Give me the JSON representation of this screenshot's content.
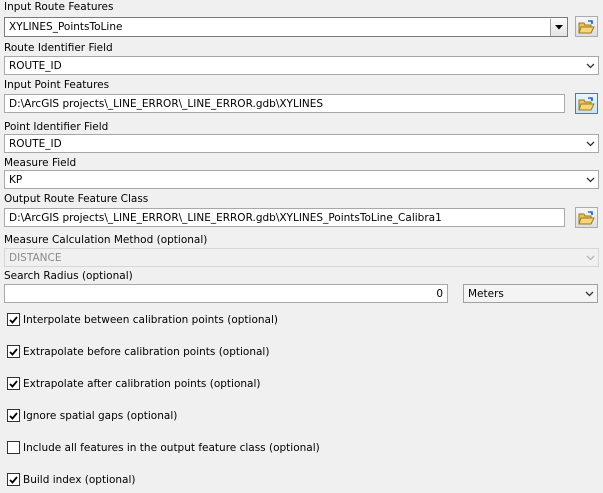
{
  "input_route_features": {
    "label": "Input Route Features",
    "value": "XYLINES_PointsToLine"
  },
  "route_identifier_field": {
    "label": "Route Identifier Field",
    "value": "ROUTE_ID"
  },
  "input_point_features": {
    "label": "Input Point Features",
    "value": "D:\\ArcGIS projects\\_LINE_ERROR\\_LINE_ERROR.gdb\\XYLINES"
  },
  "point_identifier_field": {
    "label": "Point Identifier Field",
    "value": "ROUTE_ID"
  },
  "measure_field": {
    "label": "Measure Field",
    "value": "KP"
  },
  "output_route_feature_class": {
    "label": "Output Route Feature Class",
    "value": "D:\\ArcGIS projects\\_LINE_ERROR\\_LINE_ERROR.gdb\\XYLINES_PointsToLine_Calibra1"
  },
  "measure_calculation_method": {
    "label": "Measure Calculation Method (optional)",
    "value": "DISTANCE"
  },
  "search_radius": {
    "label": "Search Radius (optional)",
    "value": "0",
    "units": "Meters"
  },
  "options": [
    {
      "label": "Interpolate between calibration points (optional)",
      "checked": true
    },
    {
      "label": "Extrapolate before calibration points (optional)",
      "checked": true
    },
    {
      "label": "Extrapolate after calibration points (optional)",
      "checked": true
    },
    {
      "label": "Ignore spatial gaps (optional)",
      "checked": true
    },
    {
      "label": "Include all features in the output feature class (optional)",
      "checked": false
    },
    {
      "label": "Build index (optional)",
      "checked": true
    }
  ],
  "icons": {
    "dropdown": "chevron-down-icon",
    "browse": "folder-open-icon",
    "check": "checkmark-icon"
  },
  "colors": {
    "background": "#f0f0f0",
    "field_border": "#a8a8a8",
    "focus_border": "#3c7fb1",
    "disabled_text": "#8a8a8a"
  }
}
